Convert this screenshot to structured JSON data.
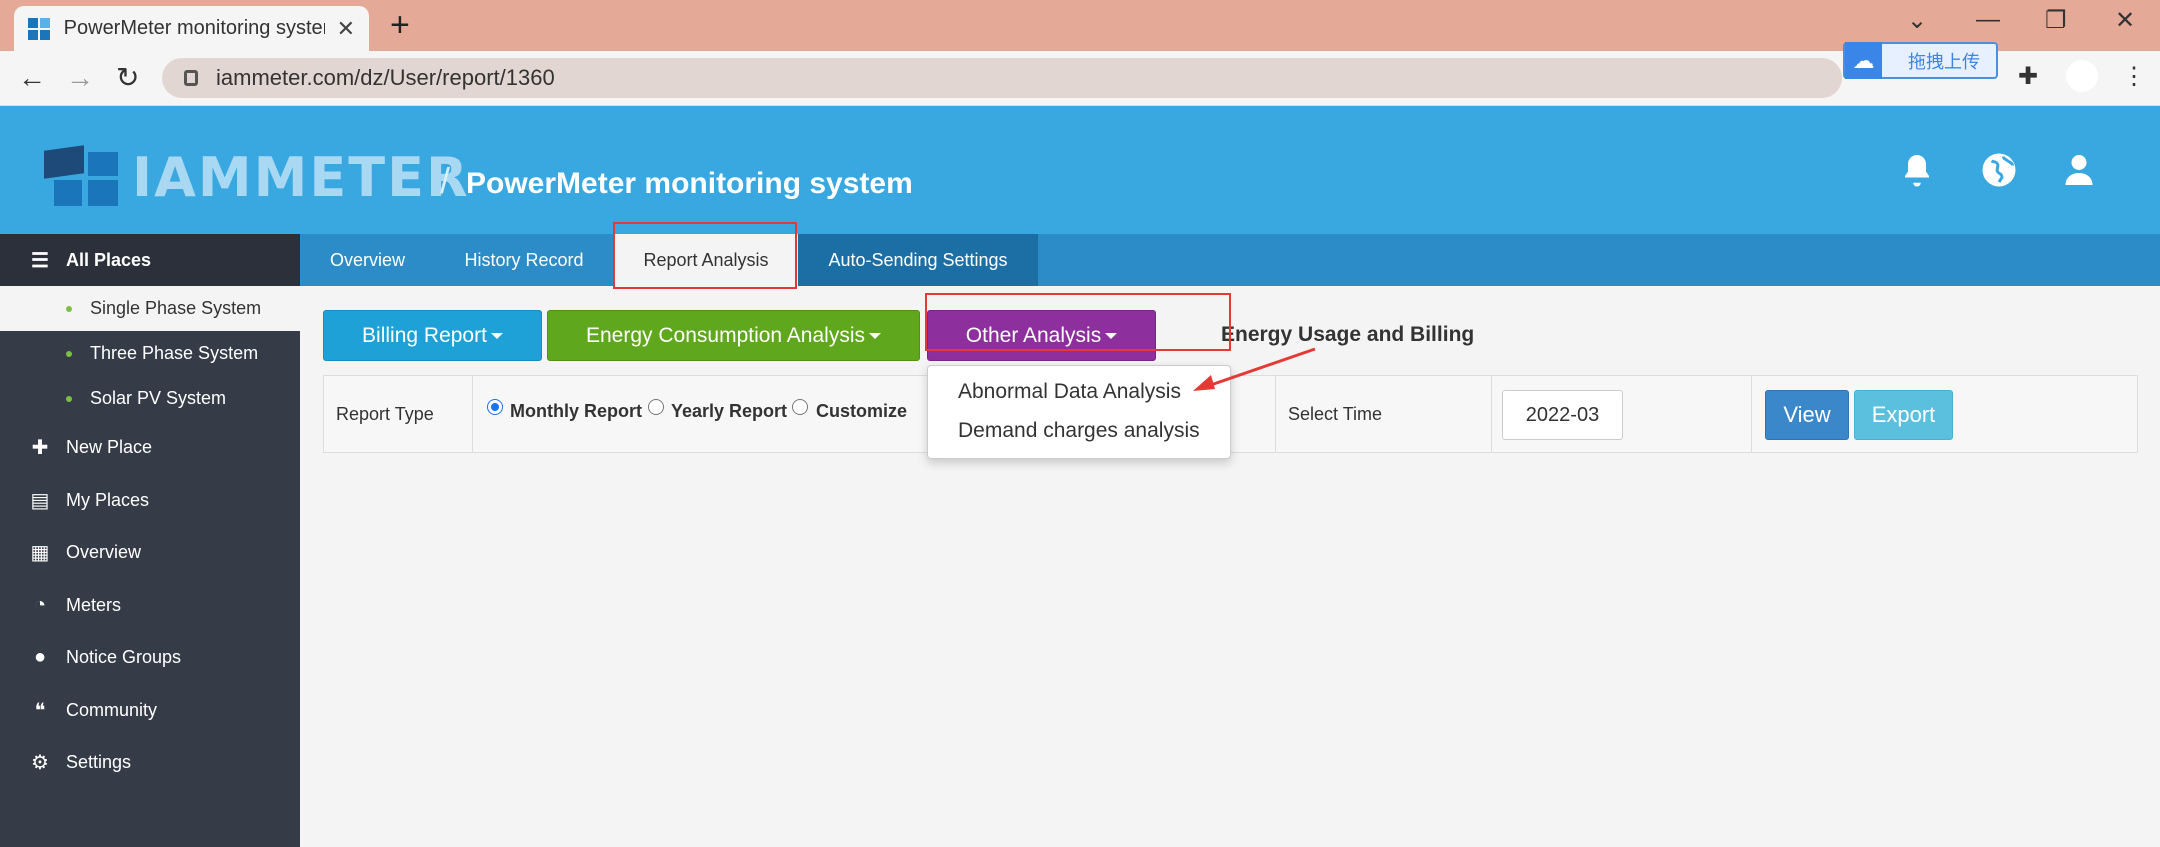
{
  "browser": {
    "tab_title": "PowerMeter monitoring system",
    "tab_close": "✕",
    "new_tab": "+",
    "url": "iammeter.com/dz/User/report/1360",
    "ext_upload_label": "拖拽上传",
    "window_controls": [
      "⌄",
      "—",
      "❐",
      "✕"
    ]
  },
  "header": {
    "logo_text": "IAMMETER",
    "slash": "/",
    "title": "PowerMeter monitoring system"
  },
  "sidebar": {
    "head": "All Places",
    "subitems": [
      "Single Phase System",
      "Three Phase System",
      "Solar PV System"
    ],
    "items": [
      "New Place",
      "My Places",
      "Overview",
      "Meters",
      "Notice Groups",
      "Community",
      "Settings"
    ]
  },
  "nav_tabs": [
    "Overview",
    "History Record",
    "Report Analysis",
    "Auto-Sending Settings"
  ],
  "buttons": {
    "billing_report": "Billing Report",
    "energy_consumption": "Energy Consumption Analysis",
    "other_analysis": "Other Analysis",
    "section_title": "Energy Usage and Billing"
  },
  "filter": {
    "report_type_label": "Report Type",
    "options": [
      "Monthly Report",
      "Yearly Report",
      "Customize"
    ],
    "selected_option": "Monthly Report",
    "select_time_label": "Select Time",
    "time_value": "2022-03",
    "view_label": "View",
    "export_label": "Export"
  },
  "dropdown": {
    "items": [
      "Abnormal Data Analysis",
      "Demand charges analysis"
    ]
  },
  "colors": {
    "header_bg": "#3aa8e0",
    "nav_bg": "#2b8cc8",
    "sidebar_bg": "#353b47",
    "billing_btn": "#1da1d6",
    "energy_btn": "#5fa81d",
    "other_btn": "#8e2f9e",
    "view_btn": "#3a87c9",
    "export_btn": "#5bc0de",
    "annotation": "#e53935"
  }
}
